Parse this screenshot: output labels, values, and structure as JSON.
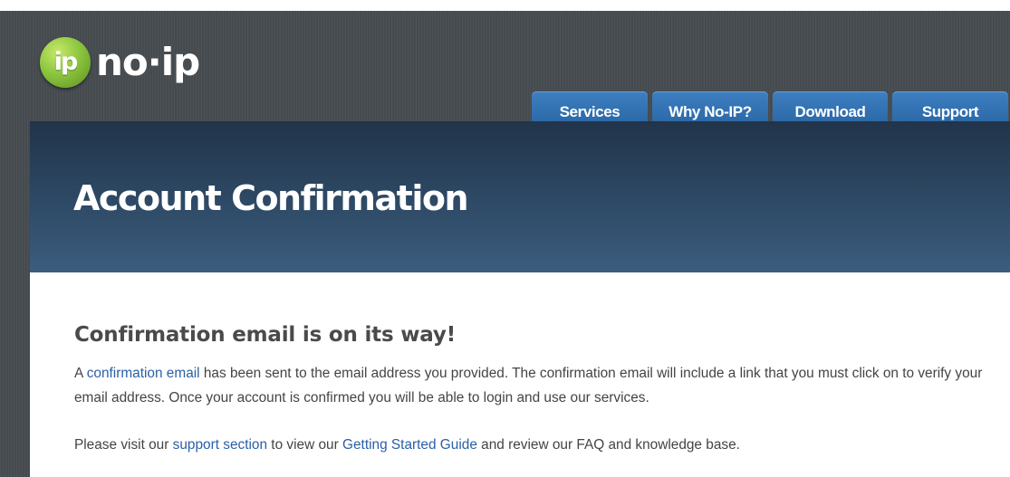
{
  "logo": {
    "mark_glyph": "ip",
    "text": "no·ip",
    "brand_color": "#8cc63f"
  },
  "nav": {
    "tabs": [
      {
        "label": "Services"
      },
      {
        "label": "Why No-IP?"
      },
      {
        "label": "Download"
      },
      {
        "label": "Support"
      }
    ],
    "tab_color": "#2f6fb0"
  },
  "hero": {
    "title": "Account Confirmation"
  },
  "content": {
    "heading": "Confirmation email is on its way!",
    "paragraph1": {
      "before_link": "A ",
      "link_text": "confirmation email",
      "after_link": " has been sent to the email address you provided. The confirmation email will include a link that you must click on to verify your email address. Once your account is confirmed you will be able to login and use our services."
    },
    "paragraph2": {
      "text_1": "Please visit our ",
      "link_1": "support section",
      "text_2": " to view our ",
      "link_2": "Getting Started Guide",
      "text_3": " and review our FAQ and knowledge base."
    },
    "link_color": "#2a5fa8"
  }
}
